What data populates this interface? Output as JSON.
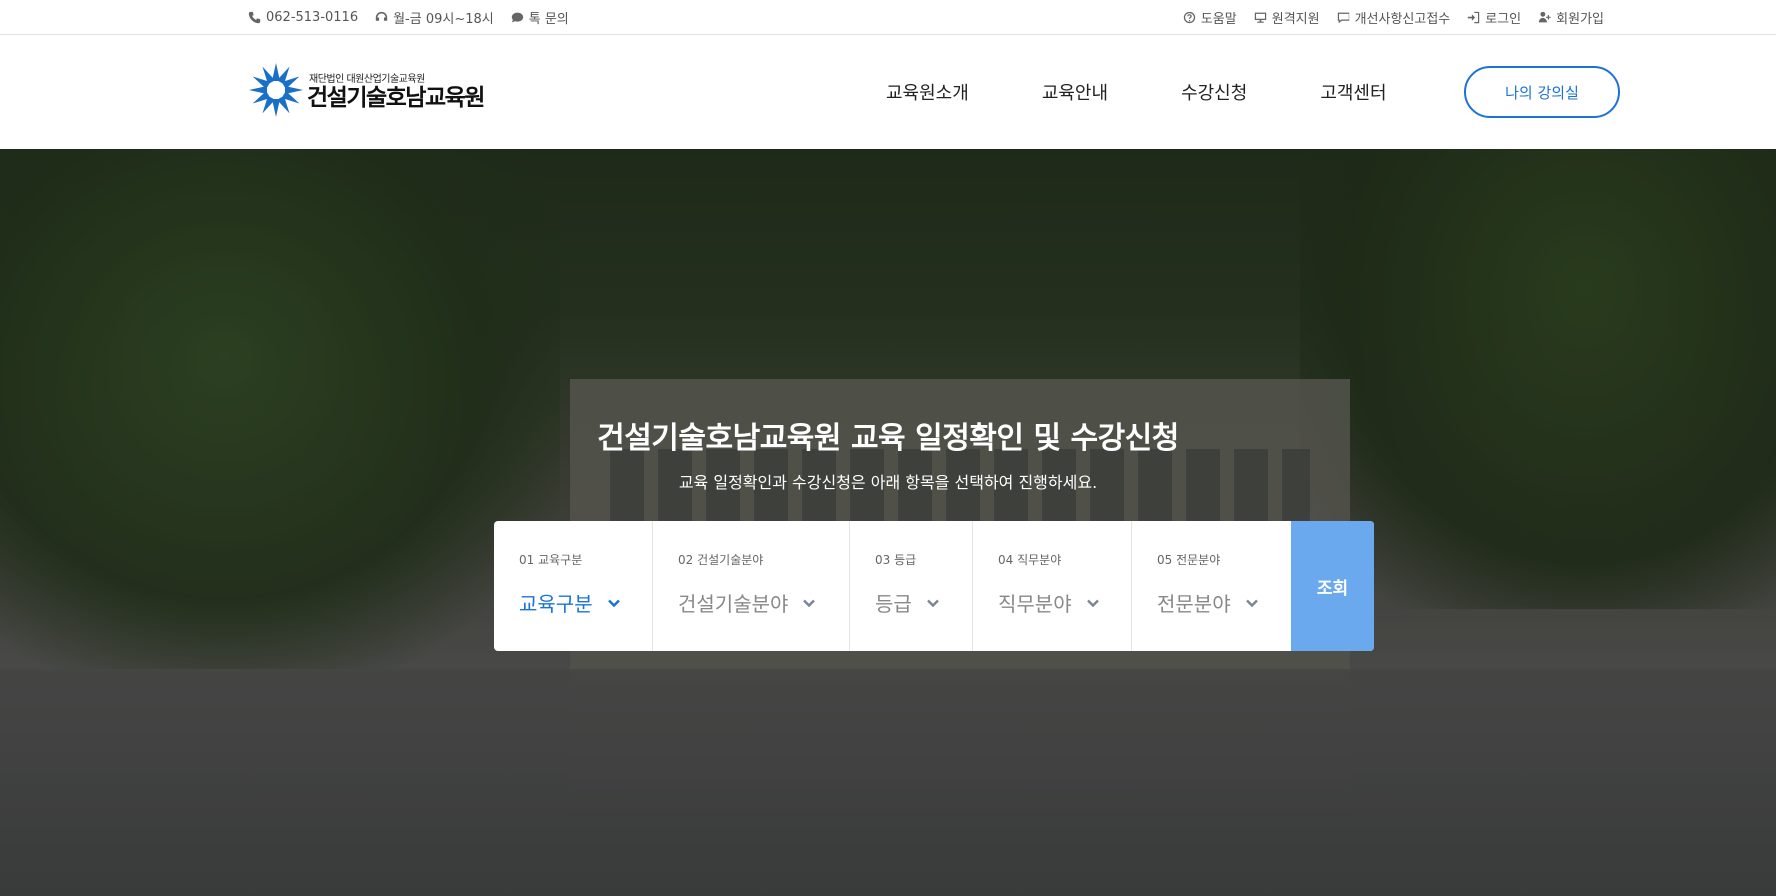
{
  "topbar": {
    "left": [
      {
        "icon": "phone-icon",
        "label": "062-513-0116"
      },
      {
        "icon": "headset-icon",
        "label": "월-금 09시~18시"
      },
      {
        "icon": "chat-icon",
        "label": "톡 문의"
      }
    ],
    "right": [
      {
        "icon": "help-icon",
        "label": "도움말"
      },
      {
        "icon": "monitor-icon",
        "label": "원격지원"
      },
      {
        "icon": "comment-icon",
        "label": "개선사항신고접수"
      },
      {
        "icon": "login-icon",
        "label": "로그인"
      },
      {
        "icon": "user-plus-icon",
        "label": "회원가입"
      }
    ]
  },
  "header": {
    "logo_sub": "재단법인 대원산업기술교육원",
    "logo_main": "건설기술호남교육원",
    "nav": [
      "교육원소개",
      "교육안내",
      "수강신청",
      "고객센터"
    ],
    "my_classroom": "나의 강의실"
  },
  "hero": {
    "title": "건설기술호남교육원 교육 일정확인 및 수강신청",
    "subtitle": "교육 일정확인과 수강신청은 아래 항목을 선택하여 진행하세요."
  },
  "search": {
    "fields": [
      {
        "num": "01 교육구분",
        "value": "교육구분"
      },
      {
        "num": "02 건설기술분야",
        "value": "건설기술분야"
      },
      {
        "num": "03 등급",
        "value": "등급"
      },
      {
        "num": "04 직무분야",
        "value": "직무분야"
      },
      {
        "num": "05 전문분야",
        "value": "전문분야"
      }
    ],
    "button": "조회"
  },
  "colors": {
    "accent": "#1b73d8",
    "search_button": "#6aa9ee"
  }
}
